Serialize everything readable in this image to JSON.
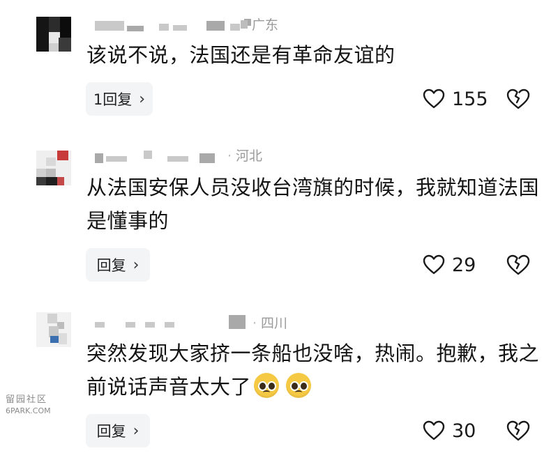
{
  "comments": [
    {
      "location": "广东",
      "text": "该说不说，法国还是有革命友谊的",
      "reply_label": "1回复",
      "likes": "155"
    },
    {
      "location": "河北",
      "text": "从法国安保人员没收台湾旗的时候，我就知道法国是懂事的",
      "reply_label": "回复",
      "likes": "29"
    },
    {
      "location": "四川",
      "text": "突然发现大家挤一条船也没啥，热闹。抱歉，我之前说话声音太大了",
      "reply_label": "回复",
      "likes": "30"
    }
  ],
  "icons": {
    "like": "heart-outline-icon",
    "dislike": "broken-heart-icon",
    "reply_arrow": "chevron-right-icon"
  },
  "watermark": {
    "line1": "留园社区",
    "line2": "6PARK.COM"
  },
  "colors": {
    "reply_bg": "#f3f4f6",
    "text": "#141414",
    "muted": "#9a9a9a"
  }
}
